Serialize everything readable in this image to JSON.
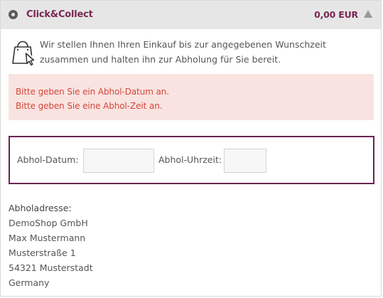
{
  "shipping_option": {
    "title": "Click&Collect",
    "price": "0,00 EUR",
    "selected": true
  },
  "intro_text": "Wir stellen Ihnen Ihren Einkauf bis zur angegebenen Wunschzeit zusammen und halten ihn zur Abholung für Sie bereit.",
  "errors": [
    "Bitte geben Sie ein Abhol-Datum an.",
    "Bitte geben Sie eine Abhol-Zeit an."
  ],
  "pickup_form": {
    "date_label": "Abhol-Datum:",
    "date_value": "",
    "time_label": "Abhol-Uhrzeit:",
    "time_value": ""
  },
  "address": {
    "heading": "Abholadresse:",
    "lines": [
      "DemoShop GmbH",
      "Max Mustermann",
      "Musterstraße 1",
      "54321 Musterstadt",
      "Germany"
    ]
  },
  "colors": {
    "brand": "#7a2752",
    "error_text": "#d4473b",
    "error_bg": "#f9e3e0",
    "form_border": "#6a2351",
    "header_bg": "#e6e6e6"
  },
  "icons": {
    "radio": "radio-selected-icon",
    "collapse": "chevron-up-icon",
    "bag": "shopping-bag-cursor-icon"
  }
}
